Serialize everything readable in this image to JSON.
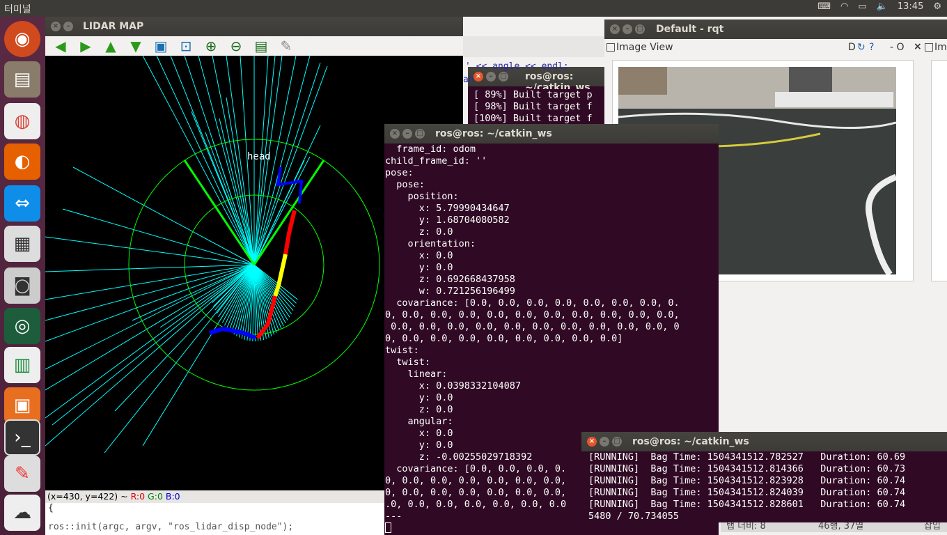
{
  "topbar": {
    "app_title": "터미널",
    "clock": "13:45"
  },
  "launcher": {
    "items": [
      "ubuntu-icon",
      "files-icon",
      "chrome-icon",
      "firefox-icon",
      "teamviewer-icon",
      "calculator-icon",
      "camera-icon",
      "webcam-icon",
      "spreadsheet-icon",
      "presentation-icon",
      "terminal-icon",
      "dock-icon",
      "dock-icon-2"
    ]
  },
  "colors": {
    "lidar_red": "#ff0000",
    "lidar_yellow": "#ffff00",
    "lidar_blue": "#0000ff",
    "lidar_cyan": "#00ffff",
    "ring_green": "#00ff00"
  },
  "lidar": {
    "title": "LIDAR MAP",
    "head_label": "head",
    "status_coords": "(x=430, y=422) ~",
    "status_r": "R:0",
    "status_g": "G:0",
    "status_b": "B:0",
    "editor_line1": "{",
    "editor_line2": "  ros::init(argc, argv, \"ros_lidar_disp_node\");"
  },
  "bg_terminal": {
    "title": "ros@ros: ~/catkin_ws",
    "frag": "' << angle << endl;",
    "frag2": "an",
    "lines": [
      "[ 89%] Built target p",
      "[ 98%] Built target f",
      "[100%] Built target f"
    ]
  },
  "odom_terminal": {
    "title": "ros@ros: ~/catkin_ws",
    "lines": [
      "  frame_id: odom",
      "child_frame_id: ''",
      "pose:",
      "  pose:",
      "    position:",
      "      x: 5.79990434647",
      "      y: 1.68704080582",
      "      z: 0.0",
      "    orientation:",
      "      x: 0.0",
      "      y: 0.0",
      "      z: 0.692668437958",
      "      w: 0.721256196499",
      "  covariance: [0.0, 0.0, 0.0, 0.0, 0.0, 0.0, 0.0, 0.",
      "0, 0.0, 0.0, 0.0, 0.0, 0.0, 0.0, 0.0, 0.0, 0.0, 0.0,",
      " 0.0, 0.0, 0.0, 0.0, 0.0, 0.0, 0.0, 0.0, 0.0, 0.0, 0",
      "0, 0.0, 0.0, 0.0, 0.0, 0.0, 0.0, 0.0, 0.0]",
      "twist:",
      "  twist:",
      "    linear:",
      "      x: 0.0398332104087",
      "      y: 0.0",
      "      z: 0.0",
      "    angular:",
      "      x: 0.0",
      "      y: 0.0",
      "      z: -0.00255029718392",
      "  covariance: [0.0, 0.0, 0.0, 0.",
      "0, 0.0, 0.0, 0.0, 0.0, 0.0, 0.0,",
      "0, 0.0, 0.0, 0.0, 0.0, 0.0, 0.0,",
      ".0, 0.0, 0.0, 0.0, 0.0, 0.0, 0.0",
      "---"
    ]
  },
  "bag_terminal": {
    "title": "ros@ros: ~/catkin_ws",
    "lines": [
      "[RUNNING]  Bag Time: 1504341512.782527   Duration: 60.69",
      "[RUNNING]  Bag Time: 1504341512.814366   Duration: 60.73",
      "[RUNNING]  Bag Time: 1504341512.823928   Duration: 60.74",
      "[RUNNING]  Bag Time: 1504341512.824039   Duration: 60.74",
      "[RUNNING]  Bag Time: 1504341512.828601   Duration: 60.74",
      "5480 / 70.734055"
    ]
  },
  "rqt": {
    "title": "Default - rqt",
    "plugin": "Image View",
    "plugin2": "Im",
    "ctrl_dc": "D",
    "ctrl_o": "- O"
  },
  "editor_status": {
    "tab_width": "탭 너비: 8",
    "position": "46행, 37열",
    "mode": "삽입"
  }
}
